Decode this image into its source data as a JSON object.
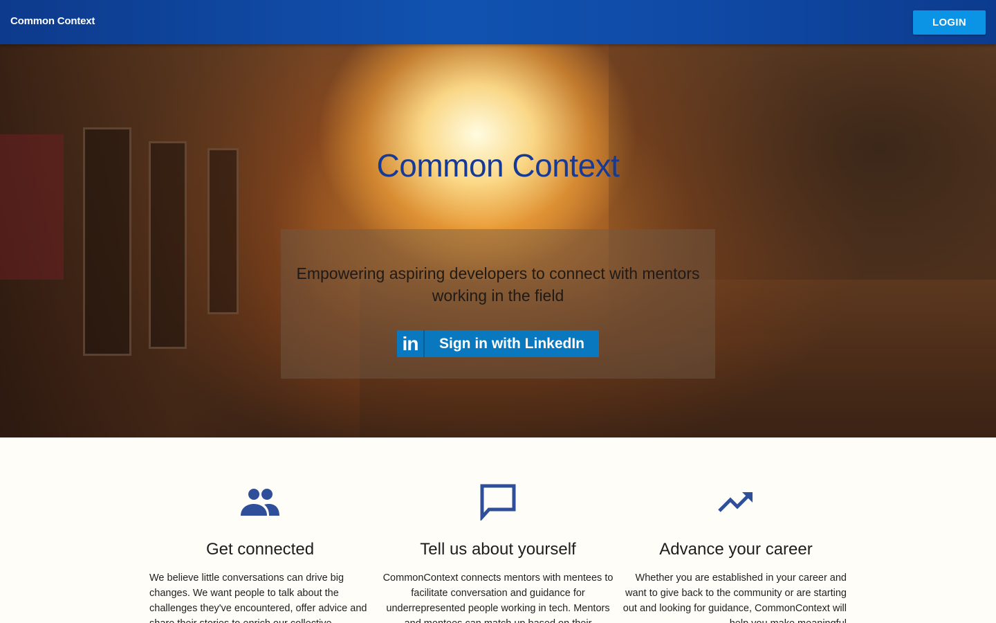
{
  "header": {
    "brand": "Common Context",
    "login_label": "LOGIN"
  },
  "hero": {
    "title": "Common Context",
    "tagline": "Empowering aspiring developers to connect with mentors working in the field",
    "linkedin_mark": "in",
    "linkedin_label": "Sign in with LinkedIn"
  },
  "features": [
    {
      "icon": "people-icon",
      "title": "Get connected",
      "text": "We believe little conversations can drive big changes. We want people to talk about the challenges they've encountered, offer advice and share their stories to enrich our collective"
    },
    {
      "icon": "chat-bubble-icon",
      "title": "Tell us about yourself",
      "text": "CommonContext connects mentors with mentees to facilitate conversation and guidance for underrepresented people working in tech. Mentors and mentees can match up based on their"
    },
    {
      "icon": "trending-up-icon",
      "title": "Advance your career",
      "text": "Whether you are established in your career and want to give back to the community or are starting out and looking for guidance, CommonContext will help you make meaningful"
    }
  ],
  "colors": {
    "navbar": "#1152b0",
    "login_button": "#0b93e6",
    "linkedin": "#0a78be",
    "hero_title": "#173a94",
    "icon": "#2f4f9a"
  }
}
